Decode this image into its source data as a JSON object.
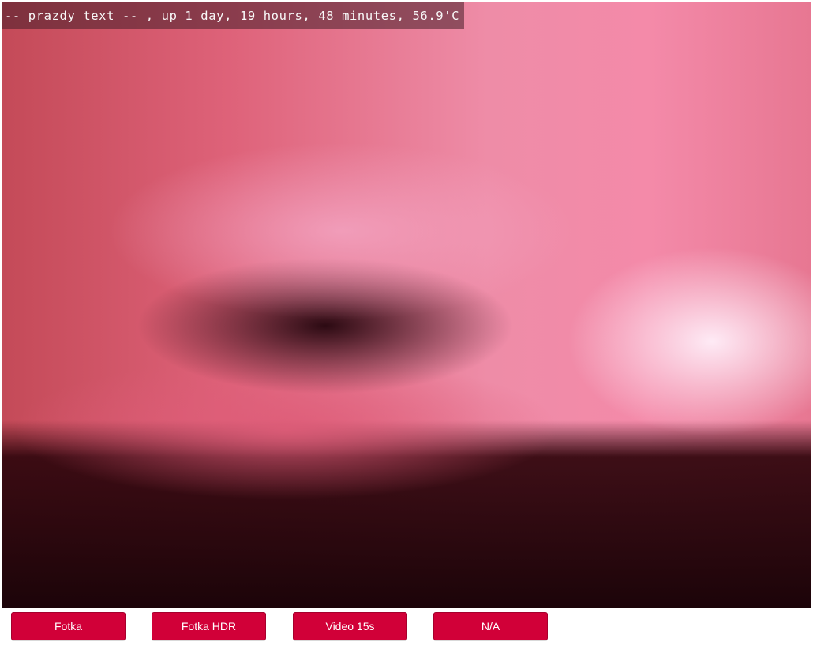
{
  "camera": {
    "status_text": "-- prazdy text -- , up 1 day, 19 hours, 48 minutes, 56.9'C"
  },
  "controls": {
    "buttons": [
      {
        "label": "Fotka"
      },
      {
        "label": "Fotka HDR"
      },
      {
        "label": "Video 15s"
      },
      {
        "label": "N/A"
      }
    ]
  },
  "colors": {
    "button_bg": "#d10038",
    "button_text": "#ffffff",
    "overlay_bg": "#461e28",
    "overlay_text": "#f8f8f8"
  }
}
